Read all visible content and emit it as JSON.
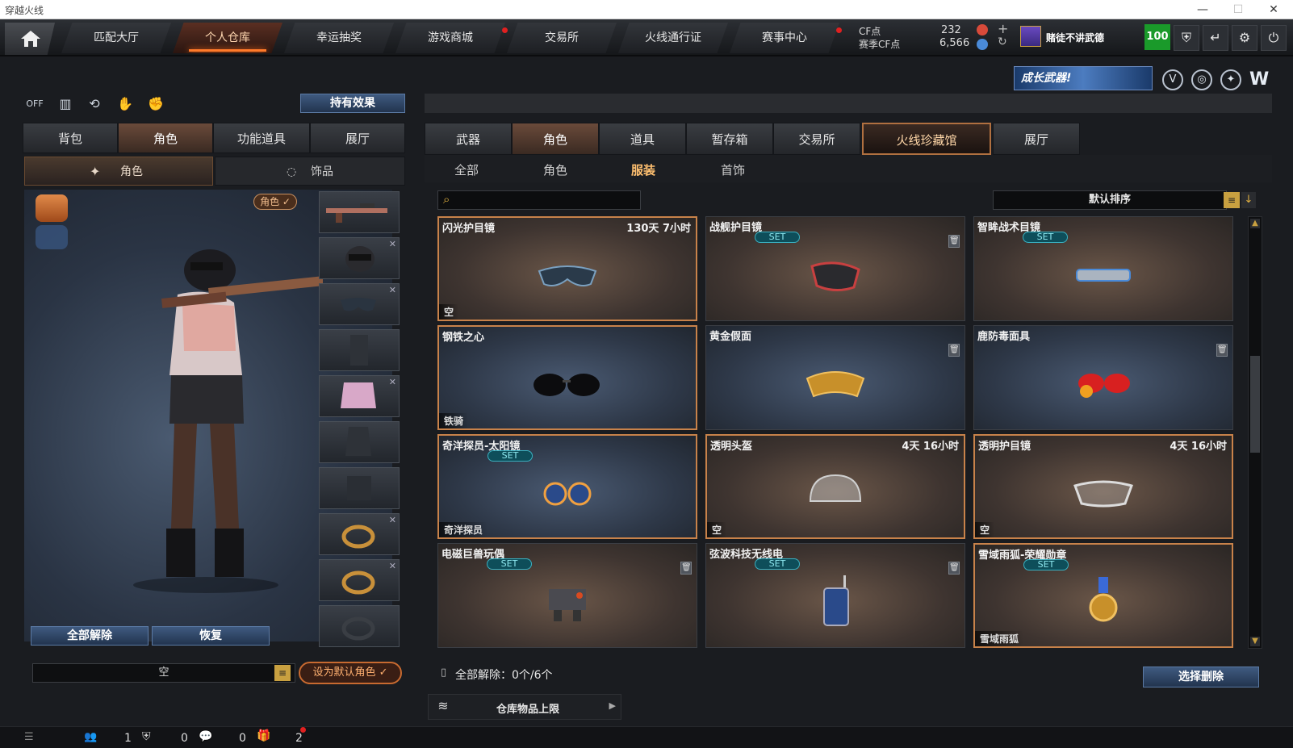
{
  "window": {
    "title": "穿越火线"
  },
  "nav": {
    "tabs": [
      "匹配大厅",
      "个人仓库",
      "幸运抽奖",
      "游戏商城",
      "交易所",
      "火线通行证",
      "赛事中心"
    ],
    "active_index": 1
  },
  "currency": {
    "cf_label": "CF点",
    "cf_value": "232",
    "season_label": "赛季CF点",
    "season_value": "6,566"
  },
  "profile": {
    "name": "赌徒不讲武德",
    "level": "100"
  },
  "banner": {
    "text": "成长武器!"
  },
  "left": {
    "hold_effect": "持有效果",
    "tabs": [
      "背包",
      "角色",
      "功能道具",
      "展厅"
    ],
    "subtabs": [
      "角色",
      "饰品"
    ],
    "char_badge": "角色 ✓",
    "unequip_all": "全部解除",
    "restore": "恢复",
    "preset_value": "空",
    "set_default": "设为默认角色 ✓"
  },
  "right": {
    "tabs": [
      "武器",
      "角色",
      "道具",
      "暂存箱",
      "交易所",
      "火线珍藏馆",
      "展厅"
    ],
    "subtabs": [
      "全部",
      "角色",
      "服装",
      "首饰"
    ],
    "sort_label": "默认排序",
    "search_placeholder": "",
    "items": [
      {
        "name": "闪光护目镜",
        "time": "130天 7小时",
        "set": false,
        "tag": "空",
        "trash": false,
        "bg": "brown",
        "selected": true
      },
      {
        "name": "战舰护目镜",
        "time": "",
        "set": true,
        "tag": "",
        "trash": true,
        "bg": "brown",
        "selected": false
      },
      {
        "name": "智眸战术目镜",
        "time": "",
        "set": true,
        "tag": "",
        "trash": false,
        "bg": "brown",
        "selected": false
      },
      {
        "name": "钢铁之心",
        "time": "",
        "set": false,
        "tag": "铁骑",
        "trash": false,
        "bg": "blue",
        "selected": true
      },
      {
        "name": "黄金假面",
        "time": "",
        "set": false,
        "tag": "",
        "trash": true,
        "bg": "blue",
        "selected": false
      },
      {
        "name": "鹿防毒面具",
        "time": "",
        "set": false,
        "tag": "",
        "trash": true,
        "bg": "blue",
        "selected": false
      },
      {
        "name": "奇洋探员-太阳镜",
        "time": "",
        "set": true,
        "tag": "奇洋探员",
        "trash": false,
        "bg": "blue",
        "selected": true
      },
      {
        "name": "透明头盔",
        "time": "4天 16小时",
        "set": false,
        "tag": "空",
        "trash": false,
        "bg": "brown",
        "selected": true
      },
      {
        "name": "透明护目镜",
        "time": "4天 16小时",
        "set": false,
        "tag": "空",
        "trash": false,
        "bg": "brown",
        "selected": true
      },
      {
        "name": "电磁巨兽玩偶",
        "time": "",
        "set": true,
        "tag": "",
        "trash": true,
        "bg": "brown",
        "selected": false
      },
      {
        "name": "弦波科技无线电",
        "time": "",
        "set": true,
        "tag": "",
        "trash": true,
        "bg": "brown",
        "selected": false
      },
      {
        "name": "雪域雨狐-荣耀勋章",
        "time": "",
        "set": true,
        "tag": "雪域雨狐",
        "trash": false,
        "bg": "brown",
        "selected": true
      }
    ],
    "set_label": "SET",
    "unequip_count": "全部解除：0个/6个",
    "select_delete": "选择删除",
    "storage_limit": "仓库物品上限"
  },
  "statusbar": {
    "friends": "1",
    "shield": "0",
    "chat": "0",
    "gift": "2"
  }
}
